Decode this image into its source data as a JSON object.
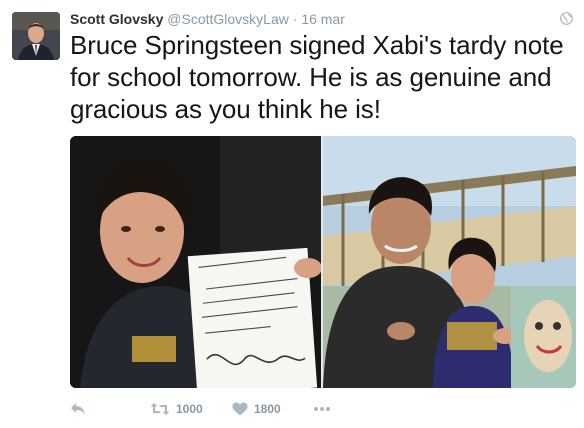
{
  "tweet": {
    "author": {
      "name": "Scott Glovsky",
      "handle": "@ScottGlovskyLaw"
    },
    "separator": "·",
    "date": "16 mar",
    "text": "Bruce Springsteen signed Xabi's tardy note for school tomorrow.  He is as genuine and gracious as you think he is!",
    "media": [
      {
        "kind": "photo",
        "note_text": "Dear Mr. Zuckow\nXabi has been out\nmy late rocking rocks.\nPlease excuse him if he\nis tardy!",
        "shirt_text": "BRUCE SPRINGSTEEN\nAND THE E STREET BAND"
      },
      {
        "kind": "photo",
        "shirt_text": "BRUCE SPRINGSTEEN\nAND THE E STREET BAND"
      }
    ],
    "actions": {
      "reply": {
        "icon": "reply-icon"
      },
      "retweet": {
        "icon": "retweet-icon",
        "count": "1000"
      },
      "like": {
        "icon": "heart-icon",
        "count": "1800"
      },
      "more": {
        "icon": "more-icon"
      }
    }
  },
  "colors": {
    "text": "#14171a",
    "name": "#292f33",
    "muted": "#8899a6"
  }
}
